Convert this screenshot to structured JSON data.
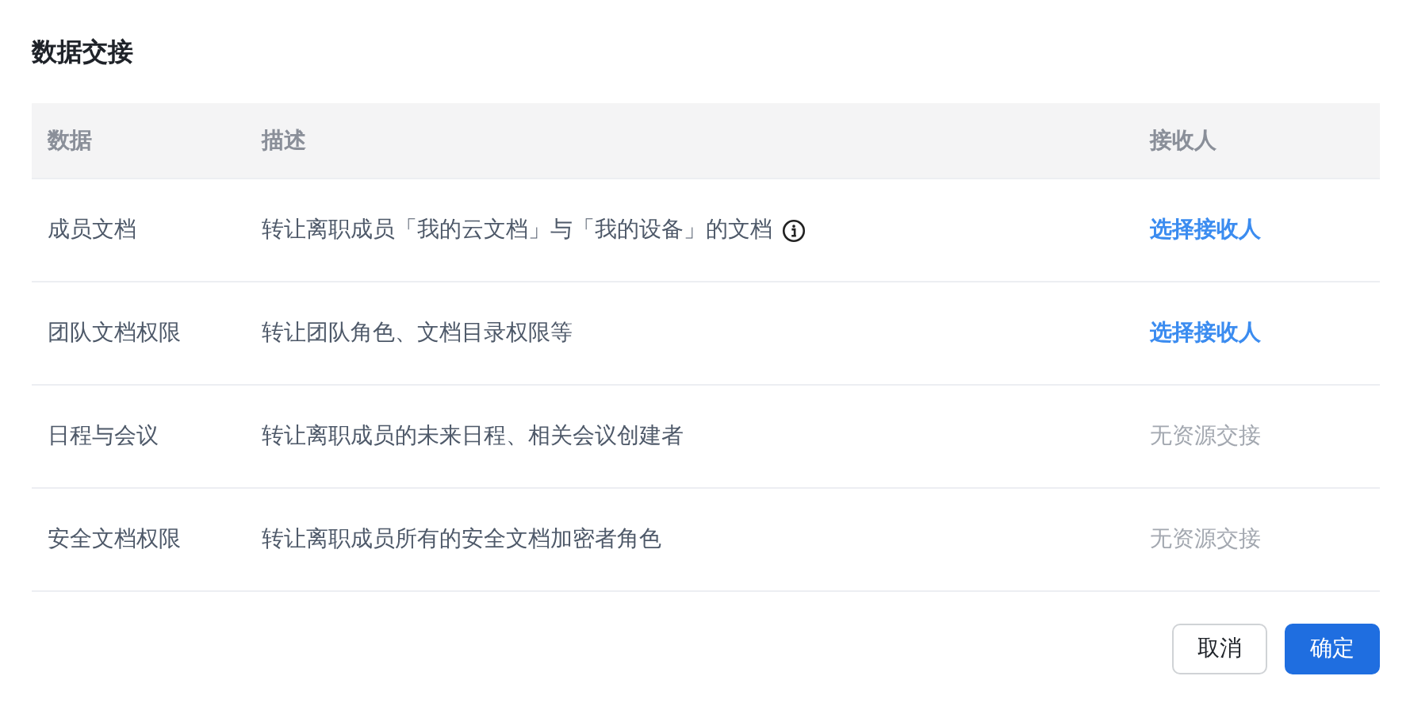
{
  "title": "数据交接",
  "table": {
    "columns": [
      "数据",
      "描述",
      "接收人"
    ],
    "rows": [
      {
        "data": "成员文档",
        "description": "转让离职成员「我的云文档」与「我的设备」的文档",
        "info": true,
        "receiver": {
          "kind": "link",
          "text": "选择接收人"
        }
      },
      {
        "data": "团队文档权限",
        "description": "转让团队角色、文档目录权限等",
        "info": false,
        "receiver": {
          "kind": "link",
          "text": "选择接收人"
        }
      },
      {
        "data": "日程与会议",
        "description": "转让离职成员的未来日程、相关会议创建者",
        "info": false,
        "receiver": {
          "kind": "none",
          "text": "无资源交接"
        }
      },
      {
        "data": "安全文档权限",
        "description": "转让离职成员所有的安全文档加密者角色",
        "info": false,
        "receiver": {
          "kind": "none",
          "text": "无资源交接"
        }
      }
    ]
  },
  "buttons": [
    {
      "kind": "secondary",
      "label": "取消"
    },
    {
      "kind": "primary",
      "label": "确定"
    }
  ]
}
